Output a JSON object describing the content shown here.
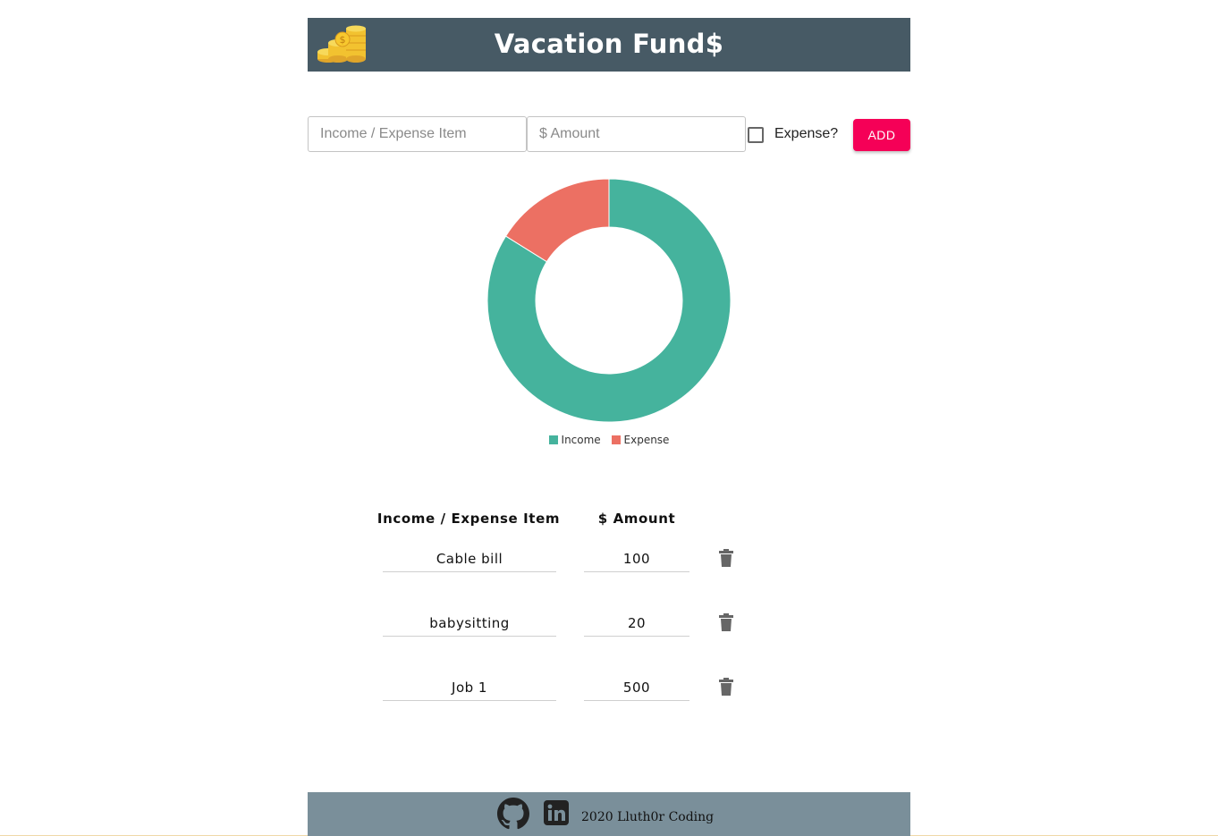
{
  "header": {
    "title": "Vacation Fund$"
  },
  "form": {
    "item_placeholder": "Income / Expense Item",
    "amount_placeholder": "$ Amount",
    "expense_label": "Expense?",
    "add_label": "ADD"
  },
  "chart_data": {
    "type": "pie",
    "variant": "doughnut",
    "categories": [
      "Income",
      "Expense"
    ],
    "values": [
      520,
      100
    ],
    "colors": [
      "#45b39d",
      "#ec7063"
    ],
    "legend_position": "bottom"
  },
  "table": {
    "headers": [
      "Income / Expense Item",
      "$ Amount"
    ],
    "rows": [
      {
        "item": "Cable bill",
        "amount": "100"
      },
      {
        "item": "babysitting",
        "amount": "20"
      },
      {
        "item": "Job 1",
        "amount": "500"
      }
    ]
  },
  "footer": {
    "text": "2020 Lluth0r Coding"
  },
  "colors": {
    "header_bg": "#475a65",
    "footer_bg": "#7a8f9a",
    "accent": "#f50057",
    "income": "#45b39d",
    "expense": "#ec7063"
  },
  "icons": [
    "coins-icon",
    "trash-icon",
    "github-icon",
    "linkedin-icon"
  ]
}
